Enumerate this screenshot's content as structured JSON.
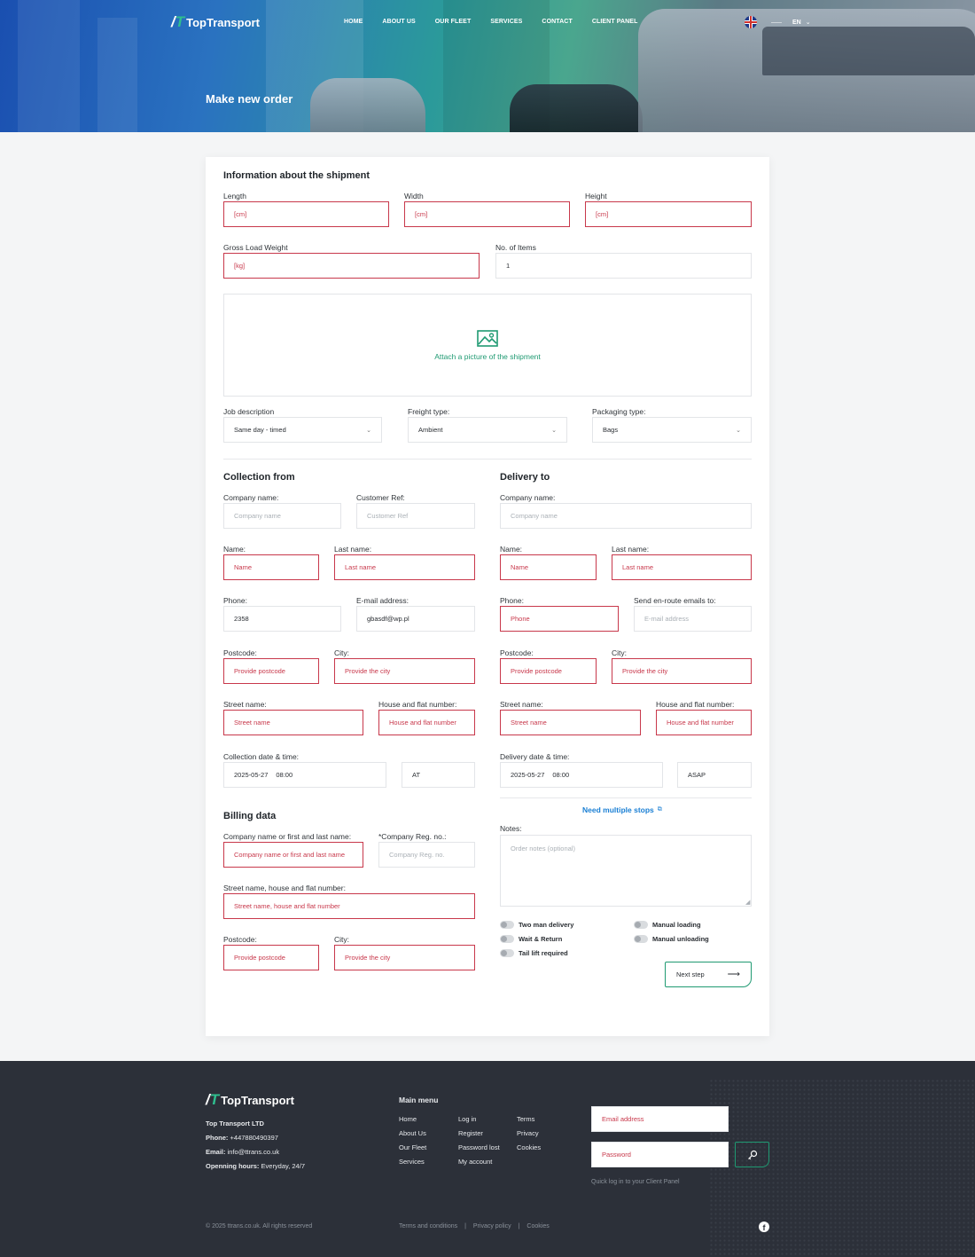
{
  "brand": {
    "name": "TopTransport"
  },
  "nav": [
    "HOME",
    "ABOUT US",
    "OUR FLEET",
    "SERVICES",
    "CONTACT",
    "CLIENT PANEL"
  ],
  "lang": {
    "code": "EN"
  },
  "page_title": "Make new order",
  "shipment": {
    "heading": "Information about the shipment",
    "length": {
      "label": "Length",
      "placeholder": "[cm]"
    },
    "width": {
      "label": "Width",
      "placeholder": "[cm]"
    },
    "height": {
      "label": "Height",
      "placeholder": "[cm]"
    },
    "weight": {
      "label": "Gross Load Weight",
      "placeholder": "[kg]"
    },
    "items": {
      "label": "No. of Items",
      "value": "1"
    },
    "attach_label": "Attach a picture of the shipment",
    "job": {
      "label": "Job description",
      "value": "Same day - timed"
    },
    "freight": {
      "label": "Freight type:",
      "value": "Ambient"
    },
    "packaging": {
      "label": "Packaging type:",
      "value": "Bags"
    }
  },
  "collection": {
    "heading": "Collection from",
    "company": {
      "label": "Company name:",
      "placeholder": "Company name"
    },
    "customer_ref": {
      "label": "Customer Ref:",
      "placeholder": "Customer Ref"
    },
    "name": {
      "label": "Name:",
      "placeholder": "Name"
    },
    "last_name": {
      "label": "Last name:",
      "placeholder": "Last name"
    },
    "phone": {
      "label": "Phone:",
      "value": "2358"
    },
    "email": {
      "label": "E-mail address:",
      "value": "gbasdf@wp.pl"
    },
    "postcode": {
      "label": "Postcode:",
      "placeholder": "Provide postcode"
    },
    "city": {
      "label": "City:",
      "placeholder": "Provide the city"
    },
    "street": {
      "label": "Street name:",
      "placeholder": "Street name"
    },
    "house": {
      "label": "House and flat number:",
      "placeholder": "House and flat number"
    },
    "datetime": {
      "label": "Collection date & time:",
      "date": "2025-05-27",
      "time": "08:00",
      "mode": "AT"
    }
  },
  "delivery": {
    "heading": "Delivery to",
    "company": {
      "label": "Company name:",
      "placeholder": "Company name"
    },
    "name": {
      "label": "Name:",
      "placeholder": "Name"
    },
    "last_name": {
      "label": "Last name:",
      "placeholder": "Last name"
    },
    "phone": {
      "label": "Phone:",
      "placeholder": "Phone"
    },
    "emails": {
      "label": "Send en-route emails to:",
      "placeholder": "E-mail address"
    },
    "postcode": {
      "label": "Postcode:",
      "placeholder": "Provide postcode"
    },
    "city": {
      "label": "City:",
      "placeholder": "Provide the city"
    },
    "street": {
      "label": "Street name:",
      "placeholder": "Street name"
    },
    "house": {
      "label": "House and flat number:",
      "placeholder": "House and flat number"
    },
    "datetime": {
      "label": "Delivery date & time:",
      "date": "2025-05-27",
      "time": "08:00",
      "mode": "ASAP"
    },
    "multi_stops": "Need multiple stops"
  },
  "billing": {
    "heading": "Billing data",
    "company": {
      "label": "Company name or first and last name:",
      "placeholder": "Company name or first and last name"
    },
    "reg": {
      "label": "*Company Reg. no.:",
      "placeholder": "Company Reg. no."
    },
    "street": {
      "label": "Street name, house and flat number:",
      "placeholder": "Street name, house and flat number"
    },
    "postcode": {
      "label": "Postcode:",
      "placeholder": "Provide postcode"
    },
    "city": {
      "label": "City:",
      "placeholder": "Provide the city"
    }
  },
  "notes": {
    "label": "Notes:",
    "placeholder": "Order notes (optional)"
  },
  "options": [
    "Two man delivery",
    "Manual loading",
    "Wait & Return",
    "Manual unloading",
    "Tail lift required"
  ],
  "next_step": "Next step",
  "footer": {
    "company": "Top Transport LTD",
    "phone_label": "Phone:",
    "phone": "+447880490397",
    "email_label": "Email:",
    "email": "info@ttrans.co.uk",
    "hours_label": "Openning hours:",
    "hours": "Everyday, 24/7",
    "menu_title": "Main menu",
    "col1": [
      "Home",
      "About Us",
      "Our Fleet",
      "Services"
    ],
    "col2": [
      "Log in",
      "Register",
      "Password lost",
      "My account"
    ],
    "col3": [
      "Terms",
      "Privacy",
      "Cookies"
    ],
    "login_email_placeholder": "Email address",
    "login_password_placeholder": "Password",
    "login_hint": "Quick log in to your Client Panel",
    "copyright": "© 2025 ttrans.co.uk. All rights reserved",
    "bottom_links": [
      "Terms and conditions",
      "Privacy policy",
      "Cookies"
    ]
  }
}
